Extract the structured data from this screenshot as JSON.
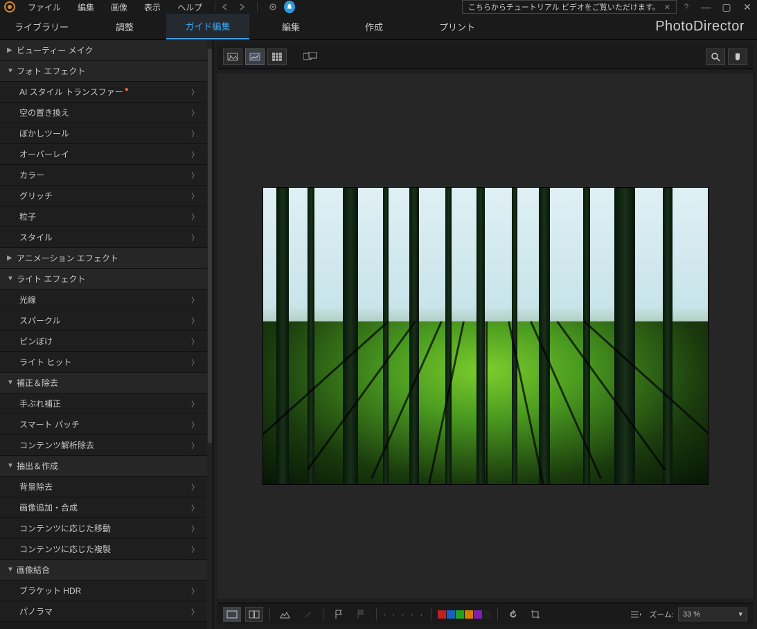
{
  "app": {
    "brand": "PhotoDirector"
  },
  "menu": [
    "ファイル",
    "編集",
    "画像",
    "表示",
    "ヘルプ"
  ],
  "tutorial_banner": "こちらからチュートリアル ビデオをご覧いただけます。",
  "modes": [
    {
      "label": "ライブラリー",
      "active": false
    },
    {
      "label": "調整",
      "active": false
    },
    {
      "label": "ガイド編集",
      "active": true
    },
    {
      "label": "編集",
      "active": false
    },
    {
      "label": "作成",
      "active": false
    },
    {
      "label": "プリント",
      "active": false
    }
  ],
  "sidebar": [
    {
      "type": "cat",
      "label": "ビューティー メイク",
      "expanded": false
    },
    {
      "type": "cat",
      "label": "フォト エフェクト",
      "expanded": true
    },
    {
      "type": "sub",
      "label": "AI スタイル トランスファー",
      "new": true
    },
    {
      "type": "sub",
      "label": "空の置き換え"
    },
    {
      "type": "sub",
      "label": "ぼかしツール"
    },
    {
      "type": "sub",
      "label": "オーバーレイ"
    },
    {
      "type": "sub",
      "label": "カラー"
    },
    {
      "type": "sub",
      "label": "グリッチ"
    },
    {
      "type": "sub",
      "label": "粒子"
    },
    {
      "type": "sub",
      "label": "スタイル"
    },
    {
      "type": "cat",
      "label": "アニメーション エフェクト",
      "expanded": false
    },
    {
      "type": "cat",
      "label": "ライト エフェクト",
      "expanded": true
    },
    {
      "type": "sub",
      "label": "光線"
    },
    {
      "type": "sub",
      "label": "スパークル"
    },
    {
      "type": "sub",
      "label": "ピンぼけ"
    },
    {
      "type": "sub",
      "label": "ライト ヒット"
    },
    {
      "type": "cat",
      "label": "補正＆除去",
      "expanded": true
    },
    {
      "type": "sub",
      "label": "手ぶれ補正"
    },
    {
      "type": "sub",
      "label": "スマート パッチ"
    },
    {
      "type": "sub",
      "label": "コンテンツ解析除去"
    },
    {
      "type": "cat",
      "label": "抽出＆作成",
      "expanded": true
    },
    {
      "type": "sub",
      "label": "背景除去"
    },
    {
      "type": "sub",
      "label": "画像追加・合成"
    },
    {
      "type": "sub",
      "label": "コンテンツに応じた移動"
    },
    {
      "type": "sub",
      "label": "コンテンツに応じた複製"
    },
    {
      "type": "cat",
      "label": "画像結合",
      "expanded": true
    },
    {
      "type": "sub",
      "label": "ブラケット HDR"
    },
    {
      "type": "sub",
      "label": "パノラマ"
    }
  ],
  "swatches": [
    "#c02020",
    "#1860c0",
    "#20a020",
    "#d08000",
    "#8020b0",
    "#202020"
  ],
  "zoom": {
    "label": "ズーム:",
    "value": "33 %"
  }
}
